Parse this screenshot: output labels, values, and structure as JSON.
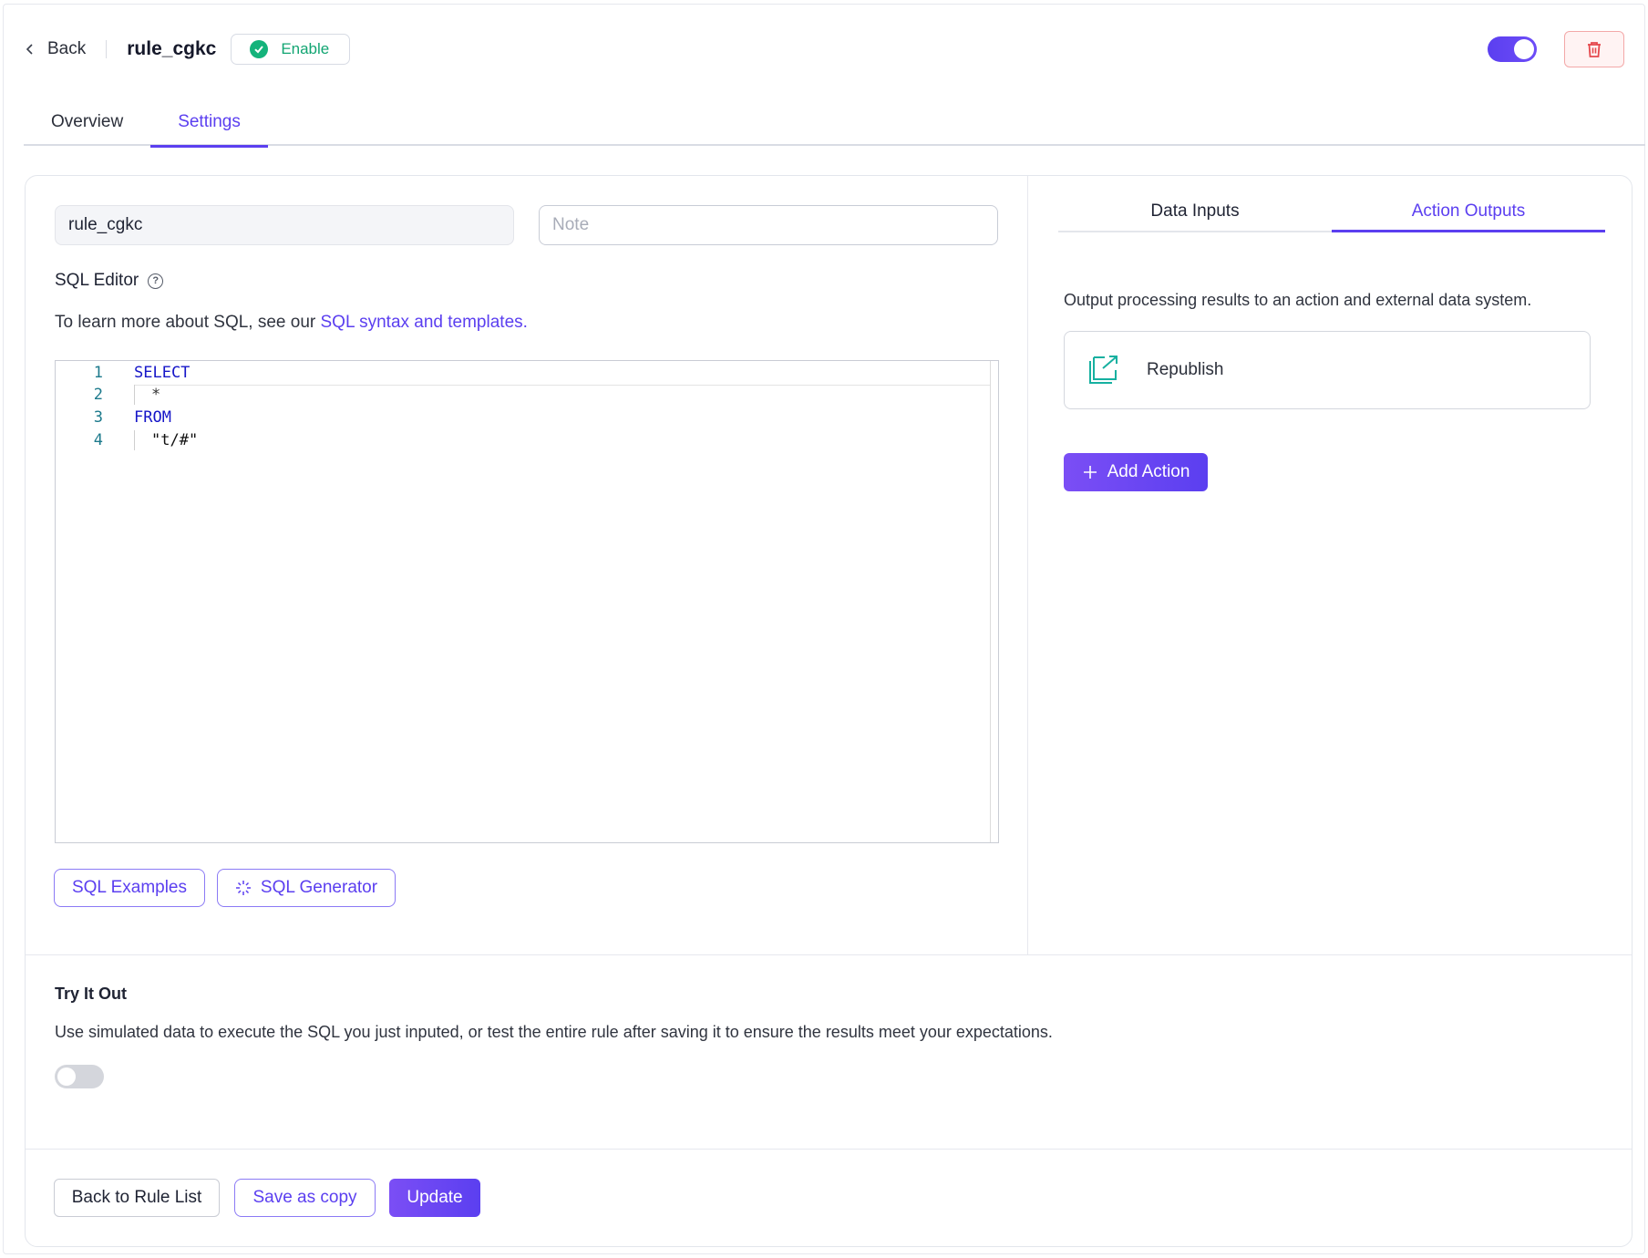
{
  "header": {
    "back_label": "Back",
    "rule_name": "rule_cgkc",
    "status_label": "Enable",
    "enabled": true
  },
  "tabs": [
    {
      "label": "Overview",
      "active": false
    },
    {
      "label": "Settings",
      "active": true
    }
  ],
  "form": {
    "name_value": "rule_cgkc",
    "note_placeholder": "Note",
    "sql_editor_label": "SQL Editor",
    "learn_prefix": "To learn more about SQL, see our ",
    "learn_link": "SQL syntax and templates."
  },
  "editor": {
    "lines": [
      {
        "number": "1",
        "text": "SELECT",
        "keyword": true,
        "indent": false
      },
      {
        "number": "2",
        "text": "*",
        "keyword": false,
        "indent": true
      },
      {
        "number": "3",
        "text": "FROM",
        "keyword": true,
        "indent": false
      },
      {
        "number": "4",
        "text": "\"t/#\"",
        "keyword": false,
        "indent": true
      }
    ]
  },
  "editor_buttons": {
    "examples": "SQL Examples",
    "generator": "SQL Generator"
  },
  "right_panel": {
    "tabs": [
      {
        "label": "Data Inputs",
        "active": false
      },
      {
        "label": "Action Outputs",
        "active": true
      }
    ],
    "description": "Output processing results to an action and external data system.",
    "actions": [
      {
        "label": "Republish",
        "icon": "republish-icon"
      }
    ],
    "add_action_label": "Add Action"
  },
  "try_it_out": {
    "title": "Try It Out",
    "description": "Use simulated data to execute the SQL you just inputed, or test the entire rule after saving it to ensure the results meet your expectations.",
    "enabled": false
  },
  "footer": {
    "back_to_list": "Back to Rule List",
    "save_copy": "Save as copy",
    "update": "Update"
  },
  "colors": {
    "accent": "#5b3ff0",
    "success": "#14b37b",
    "danger": "#e5484d"
  }
}
